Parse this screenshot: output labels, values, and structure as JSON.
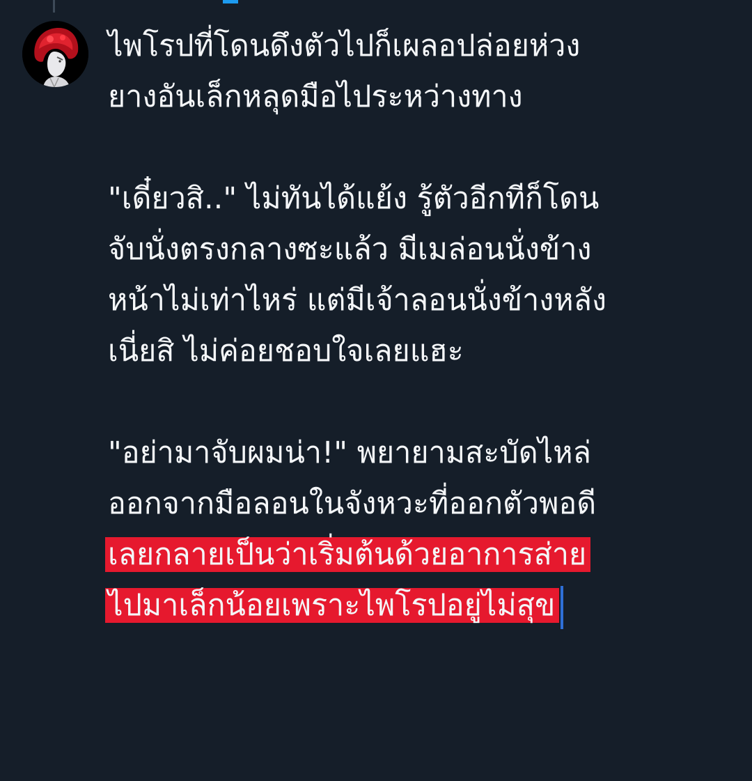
{
  "tweet": {
    "avatar_icon": "user-avatar-red-hair",
    "paragraphs": [
      [
        "ไพโรปที่โดนดึงตัวไปก็เผลอปล่อยห่วง",
        "ยางอันเล็กหลุดมือไประหว่างทาง"
      ],
      [
        "\"เดี๋ยวสิ..\" ไม่ทันได้แย้ง รู้ตัวอีกทีก็โดน",
        "จับนั่งตรงกลางซะแล้ว มีเมล่อนนั่งข้าง",
        "หน้าไม่เท่าไหร่ แต่มีเจ้าลอนนั่งข้างหลัง",
        "เนี่ยสิ ไม่ค่อยชอบใจเลยแฮะ"
      ],
      [
        "\"อย่ามาจับผมน่า!\" พยายามสะบัดไหล่",
        "ออกจากมือลอนในจังหวะที่ออกตัวพอดี"
      ]
    ],
    "highlighted_lines": [
      "เลยกลายเป็นว่าเริ่มต้นด้วยอาการส่าย",
      "ไปมาเล็กน้อยเพราะไพโรปอยู่ไม่สุข"
    ],
    "highlight_color": "#e6192e",
    "background_color": "#151e29",
    "text_color": "#f4f6f8"
  }
}
